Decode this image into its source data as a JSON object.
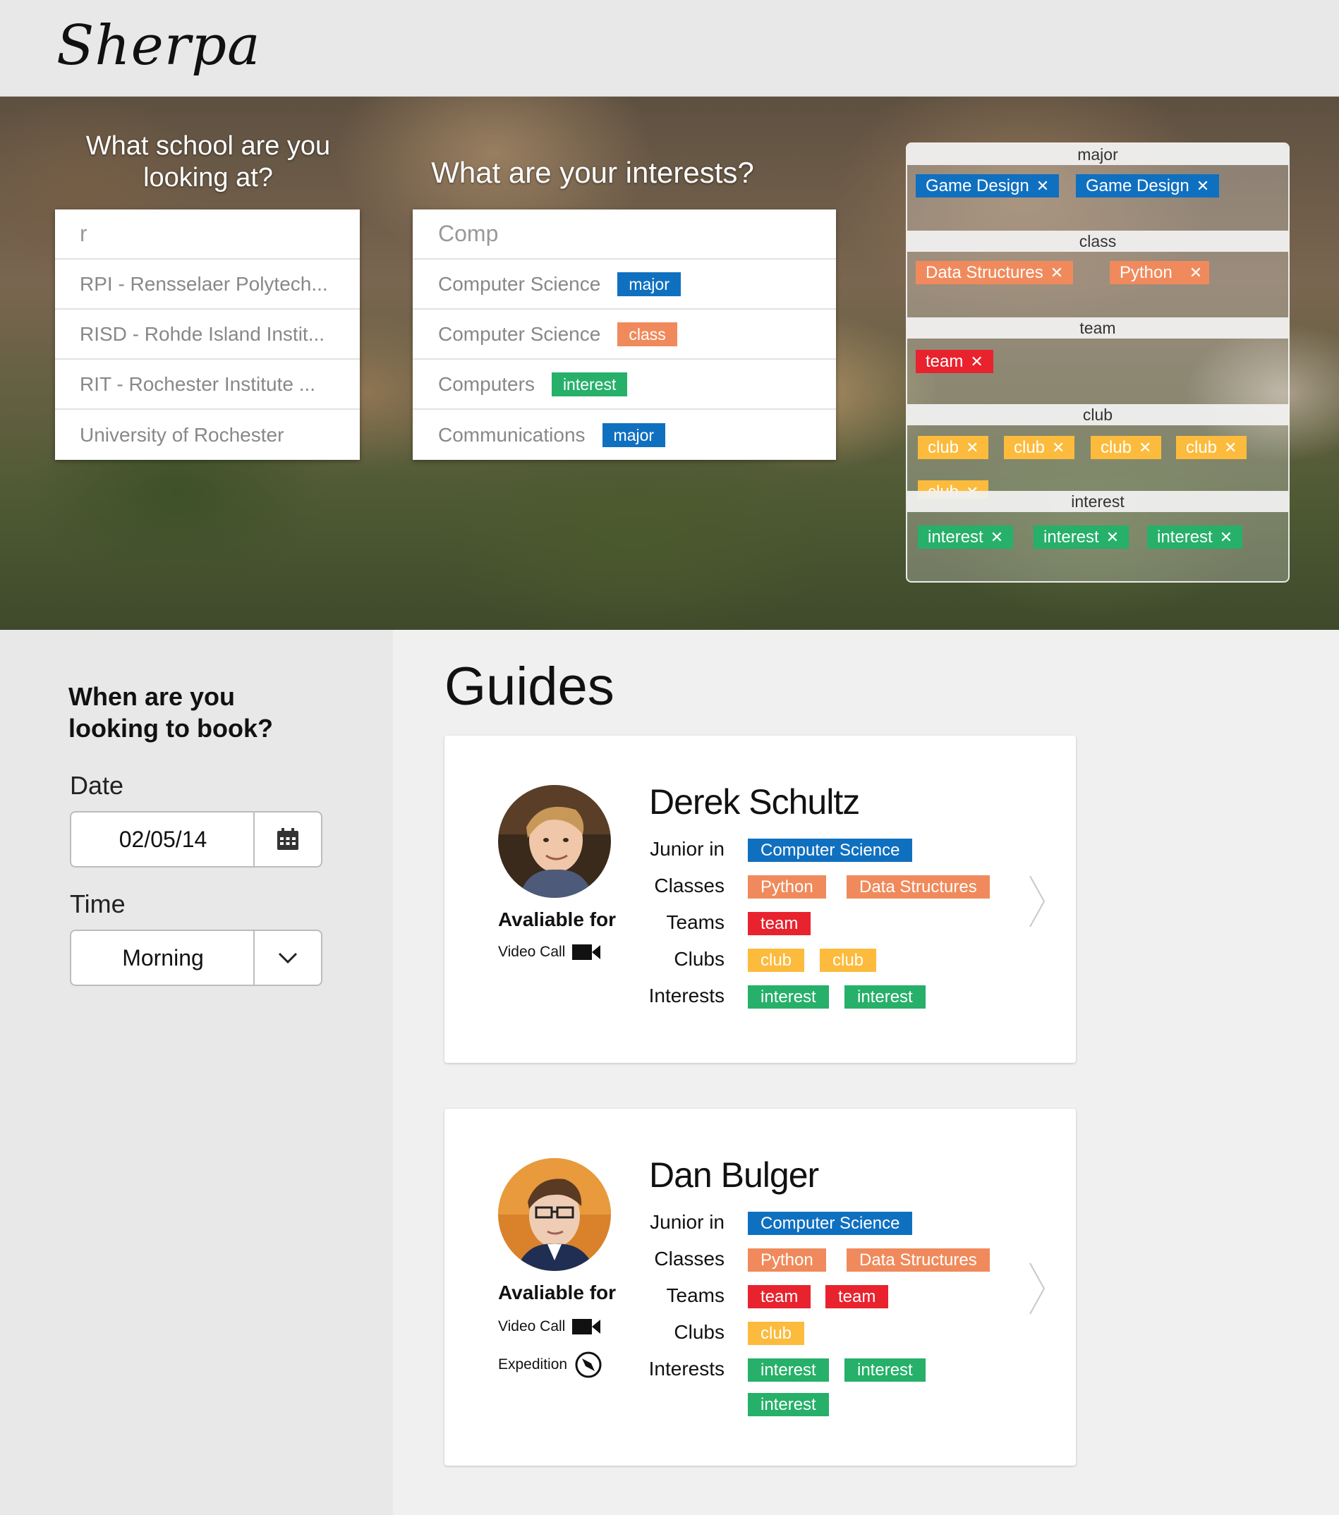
{
  "brand": {
    "logo": "Sherpa"
  },
  "search": {
    "school_question": "What school are you looking at?",
    "school_query": "r",
    "school_results": [
      "RPI - Rensselaer Polytech...",
      "RISD - Rohde Island Instit...",
      "RIT - Rochester Institute ...",
      "University of Rochester"
    ],
    "interests_question": "What are your interests?",
    "interests_query": "Comp",
    "interest_results": [
      {
        "label": "Computer Science",
        "tag": "major",
        "type": "major"
      },
      {
        "label": "Computer Science",
        "tag": "class",
        "type": "class"
      },
      {
        "label": "Computers",
        "tag": "interest",
        "type": "interest"
      },
      {
        "label": "Communications",
        "tag": "major",
        "type": "major"
      }
    ]
  },
  "selections": {
    "major": {
      "header": "major",
      "tags": [
        "Game Design",
        "Game Design"
      ]
    },
    "class": {
      "header": "class",
      "tags": [
        "Data Structures",
        "Python"
      ]
    },
    "team": {
      "header": "team",
      "tags": [
        "team"
      ]
    },
    "club": {
      "header": "club",
      "tags": [
        "club",
        "club",
        "club",
        "club",
        "club"
      ]
    },
    "interest": {
      "header": "interest",
      "tags": [
        "interest",
        "interest",
        "interest"
      ]
    },
    "remove_glyph": "✕"
  },
  "booking": {
    "title": "When are you looking to book?",
    "date_label": "Date",
    "date_value": "02/05/14",
    "time_label": "Time",
    "time_value": "Morning"
  },
  "guides": {
    "title": "Guides",
    "labels": {
      "year": "Junior in",
      "classes": "Classes",
      "teams": "Teams",
      "clubs": "Clubs",
      "interests": "Interests",
      "available": "Avaliable for"
    },
    "list": [
      {
        "name": "Derek Schultz",
        "major": "Computer Science",
        "classes": [
          "Python",
          "Data Structures"
        ],
        "teams": [
          "team"
        ],
        "clubs": [
          "club",
          "club"
        ],
        "interests": [
          "interest",
          "interest"
        ],
        "availability": [
          "Video Call"
        ]
      },
      {
        "name": "Dan Bulger",
        "major": "Computer Science",
        "classes": [
          "Python",
          "Data Structures"
        ],
        "teams": [
          "team",
          "team"
        ],
        "clubs": [
          "club"
        ],
        "interests": [
          "interest",
          "interest",
          "interest"
        ],
        "availability": [
          "Video Call",
          "Expedition"
        ]
      }
    ]
  },
  "colors": {
    "major": "#1070c0",
    "class": "#f08a5c",
    "interest": "#26b069",
    "team": "#e8232e",
    "club": "#fcbb3c"
  }
}
